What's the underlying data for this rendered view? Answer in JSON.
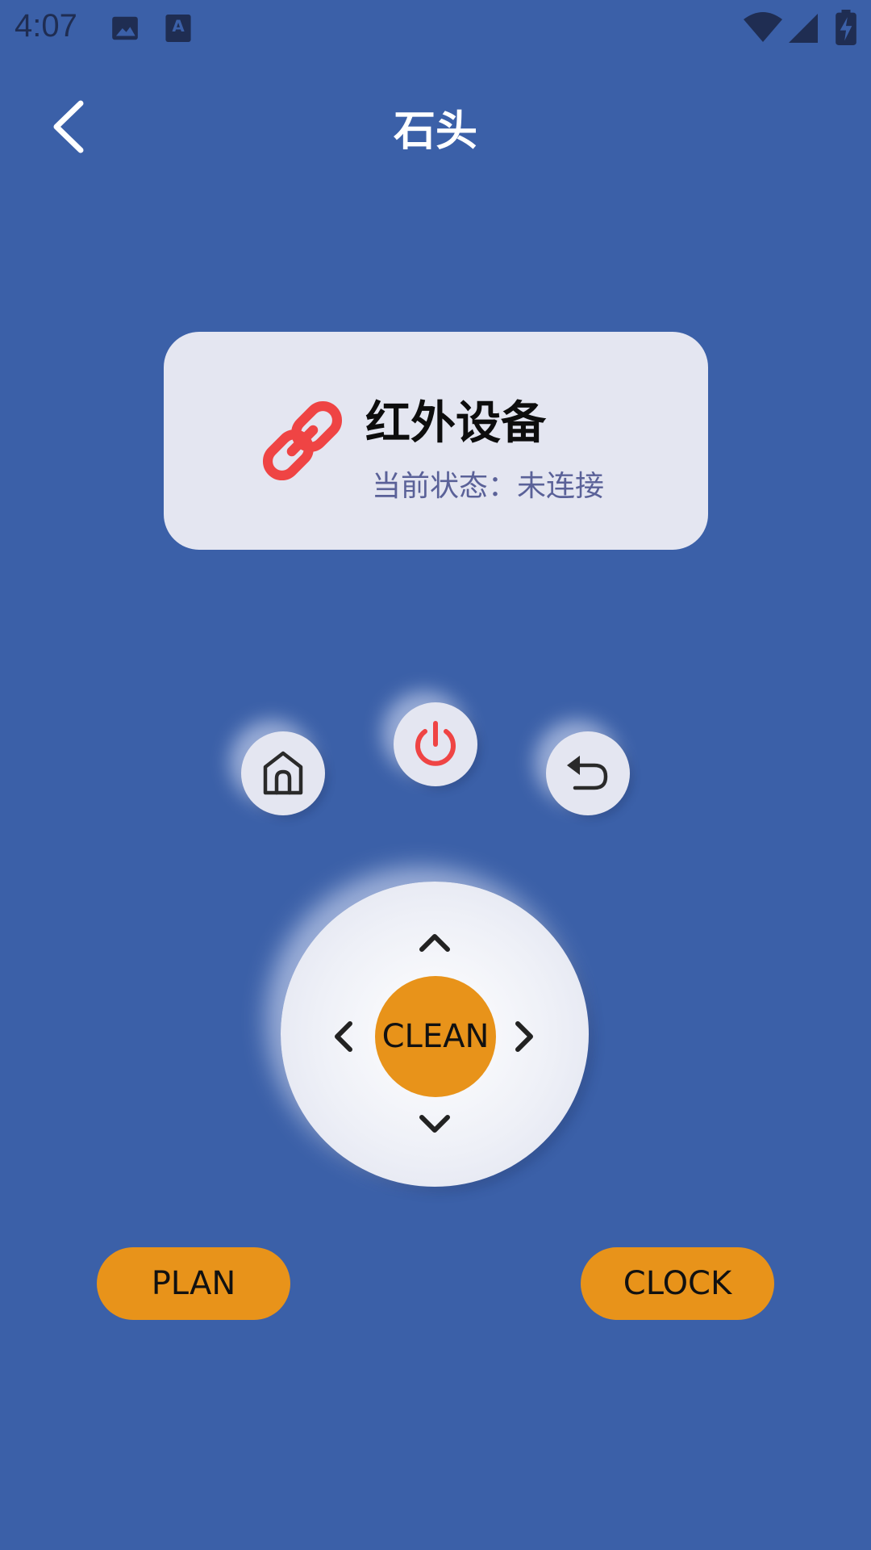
{
  "status_bar": {
    "time": "4:07",
    "icons": [
      "image-icon",
      "a-keyboard-icon",
      "wifi-icon",
      "signal-icon",
      "battery-charging-icon"
    ]
  },
  "header": {
    "title": "石头",
    "back_icon": "chevron-left-icon"
  },
  "device_card": {
    "icon": "link-icon",
    "name": "红外设备",
    "status": "当前状态：未连接",
    "icon_color": "#ef4444"
  },
  "controls": {
    "home_icon": "home-icon",
    "power_icon": "power-icon",
    "back_icon": "return-icon",
    "power_color": "#ef4444"
  },
  "dpad": {
    "up_icon": "chevron-up-icon",
    "down_icon": "chevron-down-icon",
    "left_icon": "chevron-left-icon",
    "right_icon": "chevron-right-icon",
    "center_label": "CLEAN",
    "center_color": "#e8931a"
  },
  "bottom_buttons": {
    "plan_label": "PLAN",
    "clock_label": "CLOCK"
  },
  "colors": {
    "background": "#3b60a8",
    "card": "#e4e6f1",
    "accent": "#e8931a"
  }
}
